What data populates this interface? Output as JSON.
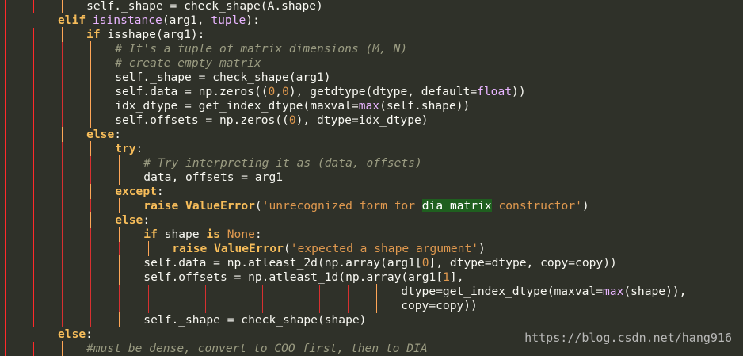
{
  "watermark": "https://blog.csdn.net/hang916",
  "lines": [
    {
      "indent": 3,
      "guides": [
        0,
        1
      ],
      "tokens": [
        [
          "pl",
          "self._shape = check_shape(A.shape)"
        ]
      ]
    },
    {
      "indent": 2,
      "guides": [
        0
      ],
      "tokens": [
        [
          "kw",
          "elif"
        ],
        [
          "pl",
          " "
        ],
        [
          "bi",
          "isinstance"
        ],
        [
          "pl",
          "(arg1, "
        ],
        [
          "bi",
          "tuple"
        ],
        [
          "pl",
          "):"
        ]
      ]
    },
    {
      "indent": 3,
      "guides": [
        0,
        1
      ],
      "tokens": [
        [
          "kw",
          "if"
        ],
        [
          "pl",
          " isshape(arg1):"
        ]
      ]
    },
    {
      "indent": 4,
      "guides": [
        0,
        1,
        2
      ],
      "tokens": [
        [
          "cm",
          "# It's a tuple of matrix dimensions (M, N)"
        ]
      ]
    },
    {
      "indent": 4,
      "guides": [
        0,
        1,
        2
      ],
      "tokens": [
        [
          "cm",
          "# create empty matrix"
        ]
      ]
    },
    {
      "indent": 4,
      "guides": [
        0,
        1,
        2
      ],
      "tokens": [
        [
          "pl",
          "self._shape = check_shape(arg1)"
        ]
      ]
    },
    {
      "indent": 4,
      "guides": [
        0,
        1,
        2
      ],
      "tokens": [
        [
          "pl",
          "self.data = np.zeros(("
        ],
        [
          "num",
          "0"
        ],
        [
          "pl",
          ","
        ],
        [
          "num",
          "0"
        ],
        [
          "pl",
          "), getdtype(dtype, default="
        ],
        [
          "bi",
          "float"
        ],
        [
          "pl",
          "))"
        ]
      ]
    },
    {
      "indent": 4,
      "guides": [
        0,
        1,
        2
      ],
      "tokens": [
        [
          "pl",
          "idx_dtype = get_index_dtype(maxval="
        ],
        [
          "bi",
          "max"
        ],
        [
          "pl",
          "(self.shape))"
        ]
      ]
    },
    {
      "indent": 4,
      "guides": [
        0,
        1,
        2
      ],
      "tokens": [
        [
          "pl",
          "self.offsets = np.zeros(("
        ],
        [
          "num",
          "0"
        ],
        [
          "pl",
          "), dtype=idx_dtype)"
        ]
      ]
    },
    {
      "indent": 3,
      "guides": [
        0,
        1
      ],
      "tokens": [
        [
          "kw",
          "else"
        ],
        [
          "pl",
          ":"
        ]
      ]
    },
    {
      "indent": 4,
      "guides": [
        0,
        1,
        2
      ],
      "tokens": [
        [
          "kw",
          "try"
        ],
        [
          "pl",
          ":"
        ]
      ]
    },
    {
      "indent": 5,
      "guides": [
        0,
        1,
        2,
        3
      ],
      "tokens": [
        [
          "cm",
          "# Try interpreting it as (data, offsets)"
        ]
      ]
    },
    {
      "indent": 5,
      "guides": [
        0,
        1,
        2,
        3
      ],
      "tokens": [
        [
          "pl",
          "data, offsets = arg1"
        ]
      ]
    },
    {
      "indent": 4,
      "guides": [
        0,
        1,
        2
      ],
      "tokens": [
        [
          "kw",
          "except"
        ],
        [
          "pl",
          ":"
        ]
      ]
    },
    {
      "indent": 5,
      "guides": [
        0,
        1,
        2,
        3
      ],
      "tokens": [
        [
          "kw",
          "raise"
        ],
        [
          "pl",
          " "
        ],
        [
          "ex",
          "ValueError"
        ],
        [
          "pl",
          "("
        ],
        [
          "str",
          "'unrecognized form for "
        ],
        [
          "hl",
          "dia_matrix"
        ],
        [
          "str",
          " constructor'"
        ],
        [
          "pl",
          ")"
        ]
      ]
    },
    {
      "indent": 4,
      "guides": [
        0,
        1,
        2
      ],
      "tokens": [
        [
          "kw",
          "else"
        ],
        [
          "pl",
          ":"
        ]
      ]
    },
    {
      "indent": 5,
      "guides": [
        0,
        1,
        2,
        3
      ],
      "tokens": [
        [
          "kw",
          "if"
        ],
        [
          "pl",
          " shape "
        ],
        [
          "kw",
          "is"
        ],
        [
          "pl",
          " "
        ],
        [
          "num",
          "None"
        ],
        [
          "pl",
          ":"
        ]
      ]
    },
    {
      "indent": 6,
      "guides": [
        0,
        1,
        2,
        3,
        4
      ],
      "tokens": [
        [
          "kw",
          "raise"
        ],
        [
          "pl",
          " "
        ],
        [
          "ex",
          "ValueError"
        ],
        [
          "pl",
          "("
        ],
        [
          "str",
          "'expected a shape argument'"
        ],
        [
          "pl",
          ")"
        ]
      ]
    },
    {
      "indent": 5,
      "guides": [
        0,
        1,
        2,
        3
      ],
      "tokens": [
        [
          "pl",
          "self.data = np.atleast_2d(np.array(arg1["
        ],
        [
          "num",
          "0"
        ],
        [
          "pl",
          "], dtype=dtype, copy=copy))"
        ]
      ]
    },
    {
      "indent": 5,
      "guides": [
        0,
        1,
        2,
        3
      ],
      "tokens": [
        [
          "pl",
          "self.offsets = np.atleast_1d(np.array(arg1["
        ],
        [
          "num",
          "1"
        ],
        [
          "pl",
          "],"
        ]
      ]
    },
    {
      "indent": 14,
      "guides": [
        0,
        1,
        2,
        3,
        4,
        5,
        6,
        7,
        8,
        9,
        10,
        11,
        12,
        13
      ],
      "tokens": [
        [
          "pl",
          "dtype=get_index_dtype(maxval="
        ],
        [
          "bi",
          "max"
        ],
        [
          "pl",
          "(shape)),"
        ]
      ]
    },
    {
      "indent": 14,
      "guides": [
        0,
        1,
        2,
        3,
        4,
        5,
        6,
        7,
        8,
        9,
        10,
        11,
        12,
        13
      ],
      "tokens": [
        [
          "pl",
          "copy=copy))"
        ]
      ]
    },
    {
      "indent": 5,
      "guides": [
        0,
        1,
        2,
        3
      ],
      "tokens": [
        [
          "pl",
          "self._shape = check_shape(shape)"
        ]
      ]
    },
    {
      "indent": 2,
      "guides": [
        0
      ],
      "tokens": [
        [
          "kw",
          "else"
        ],
        [
          "pl",
          ":"
        ]
      ]
    },
    {
      "indent": 3,
      "guides": [
        0,
        1
      ],
      "tokens": [
        [
          "cm",
          "#must be dense, convert to COO first, then to DIA"
        ]
      ]
    }
  ]
}
